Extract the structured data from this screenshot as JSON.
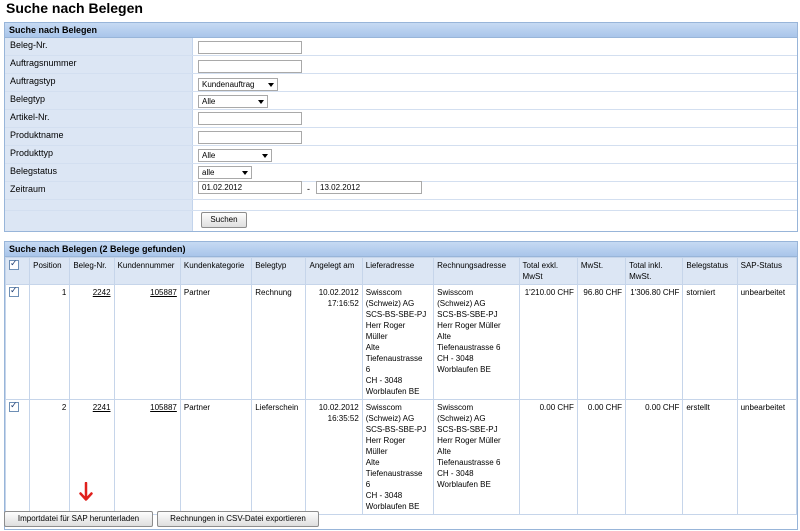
{
  "page_title": "Suche nach Belegen",
  "search": {
    "header": "Suche nach Belegen",
    "fields": {
      "beleg_nr": {
        "label": "Beleg-Nr.",
        "value": ""
      },
      "auftragsnummer": {
        "label": "Auftragsnummer",
        "value": ""
      },
      "auftragstyp": {
        "label": "Auftragstyp",
        "value": "Kundenauftrag"
      },
      "belegtyp": {
        "label": "Belegtyp",
        "value": "Alle"
      },
      "artikel_nr": {
        "label": "Artikel-Nr.",
        "value": ""
      },
      "produktname": {
        "label": "Produktname",
        "value": ""
      },
      "produkttyp": {
        "label": "Produkttyp",
        "value": "Alle"
      },
      "belegstatus": {
        "label": "Belegstatus",
        "value": "alle"
      },
      "zeitraum": {
        "label": "Zeitraum",
        "from": "01.02.2012",
        "separator": "-",
        "to": "13.02.2012"
      }
    },
    "submit_label": "Suchen"
  },
  "results": {
    "header": "Suche nach Belegen (2 Belege gefunden)",
    "columns": [
      "Position",
      "Beleg-Nr.",
      "Kundennummer",
      "Kundenkategorie",
      "Belegtyp",
      "Angelegt am",
      "Lieferadresse",
      "Rechnungsadresse",
      "Total exkl. MwSt",
      "MwSt.",
      "Total inkl. MwSt.",
      "Belegstatus",
      "SAP-Status"
    ],
    "rows": [
      {
        "checked": true,
        "position": "1",
        "beleg_nr": "2242",
        "kundennummer": "105887",
        "kundenkategorie": "Partner",
        "belegtyp": "Rechnung",
        "angelegt_date": "10.02.2012",
        "angelegt_time": "17:16:52",
        "lieferadresse": [
          "Swisscom",
          "(Schweiz) AG",
          "SCS-BS-SBE-PJ",
          "Herr Roger",
          "Müller",
          "Alte",
          "Tiefenaustrasse",
          "6",
          "CH - 3048",
          "Worblaufen BE"
        ],
        "rechnungsadresse": [
          "Swisscom",
          "(Schweiz) AG",
          "SCS-BS-SBE-PJ",
          "Herr Roger Müller",
          "Alte",
          "Tiefenaustrasse 6",
          "CH - 3048",
          "Worblaufen BE"
        ],
        "total_exkl": "1'210.00 CHF",
        "mwst": "96.80 CHF",
        "total_inkl": "1'306.80 CHF",
        "belegstatus": "storniert",
        "sap_status": "unbearbeitet"
      },
      {
        "checked": true,
        "position": "2",
        "beleg_nr": "2241",
        "kundennummer": "105887",
        "kundenkategorie": "Partner",
        "belegtyp": "Lieferschein",
        "angelegt_date": "10.02.2012",
        "angelegt_time": "16:35:52",
        "lieferadresse": [
          "Swisscom",
          "(Schweiz) AG",
          "SCS-BS-SBE-PJ",
          "Herr Roger",
          "Müller",
          "Alte",
          "Tiefenaustrasse",
          "6",
          "CH - 3048",
          "Worblaufen BE"
        ],
        "rechnungsadresse": [
          "Swisscom",
          "(Schweiz) AG",
          "SCS-BS-SBE-PJ",
          "Herr Roger Müller",
          "Alte",
          "Tiefenaustrasse 6",
          "CH - 3048",
          "Worblaufen BE"
        ],
        "total_exkl": "0.00 CHF",
        "mwst": "0.00 CHF",
        "total_inkl": "0.00 CHF",
        "belegstatus": "erstellt",
        "sap_status": "unbearbeitet"
      }
    ]
  },
  "actions": {
    "sap_download_label": "Importdatei für SAP herunterladen",
    "csv_export_label": "Rechnungen in CSV-Datei exportieren"
  },
  "colors": {
    "header_bg": "#b3cdee",
    "label_bg": "#dce6f4",
    "border": "#98b5d9",
    "arrow": "#e0201c"
  },
  "icons": {
    "annotation_arrow": "red-down-arrow-icon"
  }
}
